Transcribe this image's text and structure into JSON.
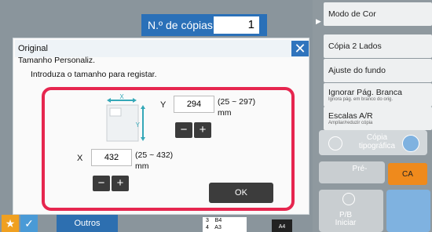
{
  "header": {
    "copies_label": "N.º de cópias",
    "copies_value": "1"
  },
  "side_menu": {
    "items": [
      {
        "label": "Modo de Cor",
        "sub": ""
      },
      {
        "label": "Cópia 2 Lados",
        "sub": ""
      },
      {
        "label": "Ajuste do fundo",
        "sub": ""
      },
      {
        "label": "Ignorar Pág. Branca",
        "sub": "Ignora pág. em branco do orig."
      },
      {
        "label": "Escalas A/R",
        "sub": "Ampliar/reduzir cópia"
      }
    ],
    "copy_tipo": "Cópia\ntipográfica",
    "pre": "Pré-",
    "ca": "CA",
    "pb_iniciar": "P/B\nIniciar"
  },
  "bottom": {
    "outros": "Outros",
    "tray_line1": "3    B4",
    "tray_line2": "4    A3",
    "paper": "A4"
  },
  "dialog": {
    "title": "Original",
    "subtitle": "Tamanho Personaliz.",
    "instruction": "Introduza o tamanho para registar.",
    "y_label": "Y",
    "y_value": "294",
    "y_range": "(25 ~ 297)",
    "y_unit": "mm",
    "x_label": "X",
    "x_value": "432",
    "x_range": "(25 ~ 432)",
    "x_unit": "mm",
    "minus": "−",
    "plus": "+",
    "ok": "OK",
    "diagram_x": "X",
    "diagram_y": "Y"
  },
  "colors": {
    "accent": "#2f74bd",
    "highlight": "#e6264f",
    "ca": "#ef8a1c"
  }
}
